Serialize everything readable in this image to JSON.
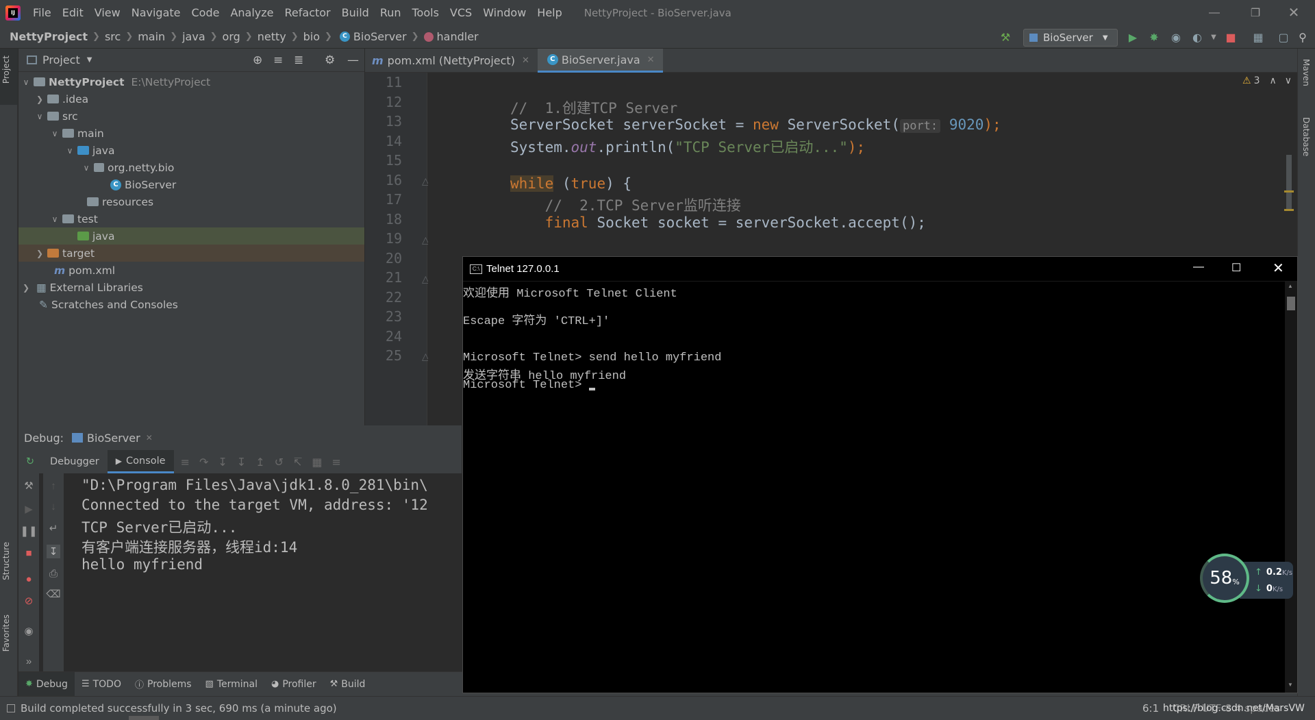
{
  "menu": {
    "items": [
      "File",
      "Edit",
      "View",
      "Navigate",
      "Code",
      "Analyze",
      "Refactor",
      "Build",
      "Run",
      "Tools",
      "VCS",
      "Window",
      "Help"
    ],
    "title": "NettyProject - BioServer.java"
  },
  "breadcrumb": {
    "items": [
      "NettyProject",
      "src",
      "main",
      "java",
      "org",
      "netty",
      "bio",
      "BioServer",
      "handler"
    ]
  },
  "toolbar": {
    "run_config": "BioServer"
  },
  "left_strip": {
    "project": "Project",
    "structure": "Structure",
    "favorites": "Favorites"
  },
  "right_strip": {
    "maven": "Maven",
    "database": "Database"
  },
  "project_panel": {
    "title": "Project",
    "tree": [
      {
        "label": "NettyProject",
        "extra": "E:\\NettyProject"
      },
      {
        "label": ".idea"
      },
      {
        "label": "src"
      },
      {
        "label": "main"
      },
      {
        "label": "java"
      },
      {
        "label": "org.netty.bio"
      },
      {
        "label": "BioServer"
      },
      {
        "label": "resources"
      },
      {
        "label": "test"
      },
      {
        "label": "java"
      },
      {
        "label": "target"
      },
      {
        "label": "pom.xml"
      },
      {
        "label": "External Libraries"
      },
      {
        "label": "Scratches and Consoles"
      }
    ]
  },
  "editor": {
    "tabs": [
      {
        "label": "pom.xml (NettyProject)"
      },
      {
        "label": "BioServer.java"
      }
    ],
    "warnings": "3",
    "line_numbers": [
      "11",
      "12",
      "13",
      "14",
      "15",
      "16",
      "17",
      "18",
      "19",
      "20",
      "21",
      "22",
      "23",
      "24",
      "25"
    ],
    "code": {
      "l12": "//  1.创建TCP Server",
      "l13_a": "ServerSocket serverSocket = ",
      "l13_kw": "new",
      "l13_b": " ServerSocket(",
      "l13_hint": "port:",
      "l13_num": "9020",
      "l13_c": ");",
      "l14_a": "System.",
      "l14_fld": "out",
      "l14_b": ".println(",
      "l14_str": "\"TCP Server已启动...\"",
      "l14_c": ");",
      "l16_kw": "while",
      "l16_a": " (",
      "l16_kw2": "true",
      "l16_b": ") {",
      "l17": "    //  2.TCP Server监听连接",
      "l18_kw": "    final",
      "l18_a": " Socket socket = serverSocket.accept();"
    }
  },
  "debug": {
    "label": "Debug:",
    "session": "BioServer",
    "tabs": [
      "Debugger",
      "Console"
    ],
    "console_lines": [
      "\"D:\\Program Files\\Java\\jdk1.8.0_281\\bin\\",
      "Connected to the target VM, address: '12",
      "TCP Server已启动...",
      "有客户端连接服务器，线程id:14",
      "hello myfriend"
    ]
  },
  "bottom_tabs": [
    "Debug",
    "TODO",
    "Problems",
    "Terminal",
    "Profiler",
    "Build"
  ],
  "status": {
    "message": "Build completed successfully in 3 sec, 690 ms (a minute ago)",
    "position": "6:1",
    "encoding": "CRLF  UTF-8  4 spaces",
    "watermark": "https://blog.csdn.net/MarsVW"
  },
  "telnet": {
    "title": "Telnet 127.0.0.1",
    "lines": [
      "欢迎使用 Microsoft Telnet Client",
      "",
      "Escape 字符为 'CTRL+]'",
      "",
      "",
      "Microsoft Telnet> send hello myfriend",
      "发送字符串 hello myfriend",
      "Microsoft Telnet> "
    ]
  },
  "net_widget": {
    "percent": "58",
    "percent_unit": "%",
    "up": "0.2",
    "up_unit": "K/s",
    "down": "0",
    "down_unit": "K/s"
  }
}
